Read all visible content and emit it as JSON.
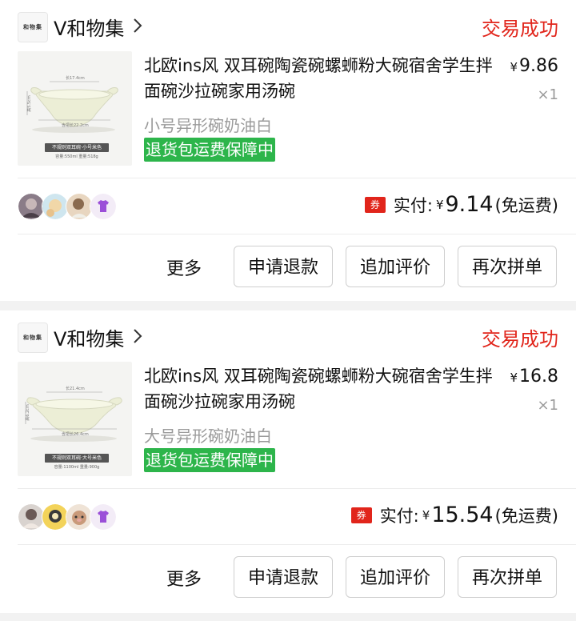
{
  "orders": [
    {
      "shop_logo_text": "和物集",
      "shop_name": "V和物集",
      "status": "交易成功",
      "title": "北欧ins风 双耳碗陶瓷碗螺蛳粉大碗宿舍学生拌面碗沙拉碗家用汤碗",
      "variant": "小号异形碗奶油白",
      "guarantee": "退货包运费保障中",
      "price_symbol": "¥",
      "price": "9.86",
      "quantity": "×1",
      "thumb_tag": "不规则双耳碗·小号米色",
      "thumb_spec": "容量:550ml  重量:518g",
      "thumb_dim_top": "长17.4cm",
      "thumb_dim_bottom": "含把长22.2cm",
      "thumb_dim_side": "高5.5cm",
      "coupon": "券",
      "paid_label": "实付:",
      "paid_symbol": "¥",
      "paid_amount": "9.14",
      "shipping_note": "(免运费)",
      "more": "更多",
      "buttons": [
        "申请退款",
        "追加评价",
        "再次拼单"
      ]
    },
    {
      "shop_logo_text": "和物集",
      "shop_name": "V和物集",
      "status": "交易成功",
      "title": "北欧ins风 双耳碗陶瓷碗螺蛳粉大碗宿舍学生拌面碗沙拉碗家用汤碗",
      "variant": "大号异形碗奶油白",
      "guarantee": "退货包运费保障中",
      "price_symbol": "¥",
      "price": "16.8",
      "quantity": "×1",
      "thumb_tag": "不规则双耳碗·大号米色",
      "thumb_spec": "容量:1100ml  重量:900g",
      "thumb_dim_top": "长21.4cm",
      "thumb_dim_bottom": "含把长26.4cm",
      "thumb_dim_side": "高6.2cm",
      "coupon": "券",
      "paid_label": "实付:",
      "paid_symbol": "¥",
      "paid_amount": "15.54",
      "shipping_note": "(免运费)",
      "more": "更多",
      "buttons": [
        "申请退款",
        "追加评价",
        "再次拼单"
      ]
    }
  ],
  "colors": {
    "status_red": "#e1251b",
    "guarantee_green": "#2db54b",
    "background": "#f2f2f2"
  },
  "icons": [
    "chevron-right-icon",
    "coupon-icon",
    "avatar"
  ]
}
